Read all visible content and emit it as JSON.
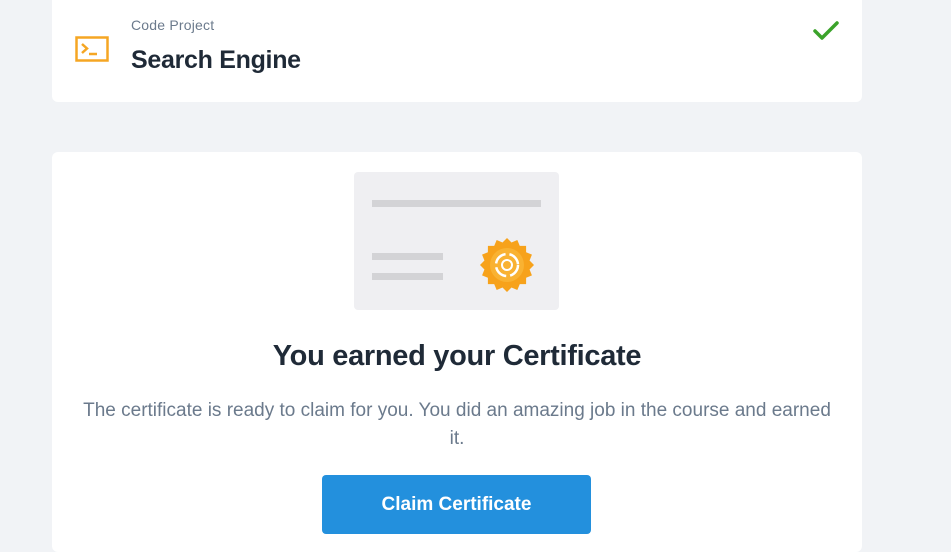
{
  "project": {
    "kind": "Code Project",
    "title": "Search Engine",
    "icon": "terminal-icon",
    "icon_color": "#f5a623",
    "status_icon": "checkmark-icon",
    "status_color": "#3ba32a"
  },
  "certificate": {
    "illustration_icon": "certificate-icon",
    "seal_icon": "seal-icon",
    "seal_color": "#f7a21b",
    "heading": "You earned your Certificate",
    "description": "The certificate is ready to claim for you. You did an amazing job in the course and earned it.",
    "claim_label": "Claim Certificate",
    "button_color": "#2390dd"
  }
}
